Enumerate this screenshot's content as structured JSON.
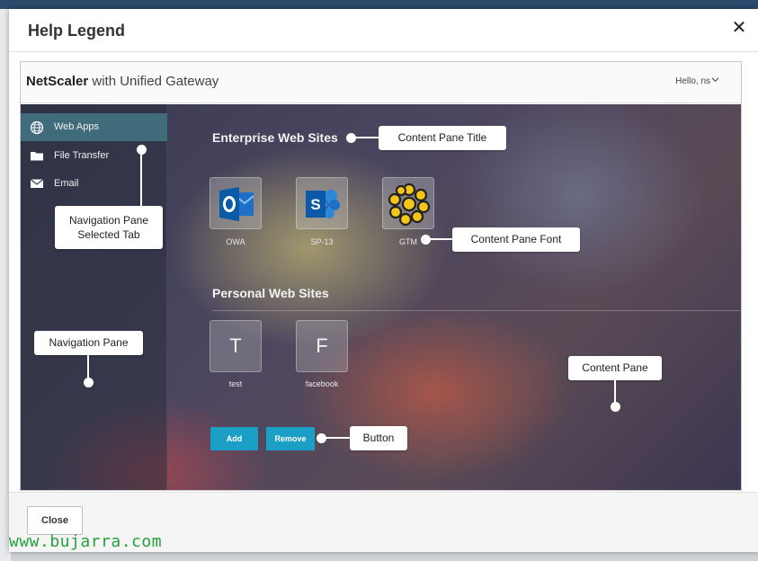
{
  "dialog": {
    "title": "Help Legend",
    "close_glyph": "✕",
    "close_label": "Close"
  },
  "preview": {
    "brand_bold": "NetScaler",
    "brand_rest": " with Unified Gateway",
    "user_greeting": "Hello, ns",
    "nav": {
      "items": [
        {
          "label": "Web Apps",
          "icon": "globe-icon",
          "selected": true
        },
        {
          "label": "File Transfer",
          "icon": "folder-icon",
          "selected": false
        },
        {
          "label": "Email",
          "icon": "envelope-icon",
          "selected": false
        }
      ]
    },
    "sections": {
      "enterprise_title": "Enterprise Web Sites",
      "personal_title": "Personal Web Sites"
    },
    "enterprise_apps": [
      {
        "label": "OWA",
        "icon": "outlook-icon"
      },
      {
        "label": "SP-13",
        "icon": "sharepoint-icon"
      },
      {
        "label": "GTM",
        "icon": "flower-icon"
      }
    ],
    "personal_apps": [
      {
        "letter": "T",
        "label": "test"
      },
      {
        "letter": "F",
        "label": "facebook"
      }
    ],
    "buttons": {
      "add": "Add",
      "remove": "Remove"
    }
  },
  "callouts": {
    "content_pane_title": "Content Pane Title",
    "content_pane_font": "Content Pane Font",
    "nav_selected_tab_line1": "Navigation Pane",
    "nav_selected_tab_line2": "Selected Tab",
    "navigation_pane": "Navigation Pane",
    "content_pane": "Content Pane",
    "button": "Button"
  },
  "watermark": "www.bujarra.com",
  "colors": {
    "accent_button": "#1b9fc6",
    "selected_tab": "#3f6b7b",
    "watermark": "#23a23a"
  }
}
